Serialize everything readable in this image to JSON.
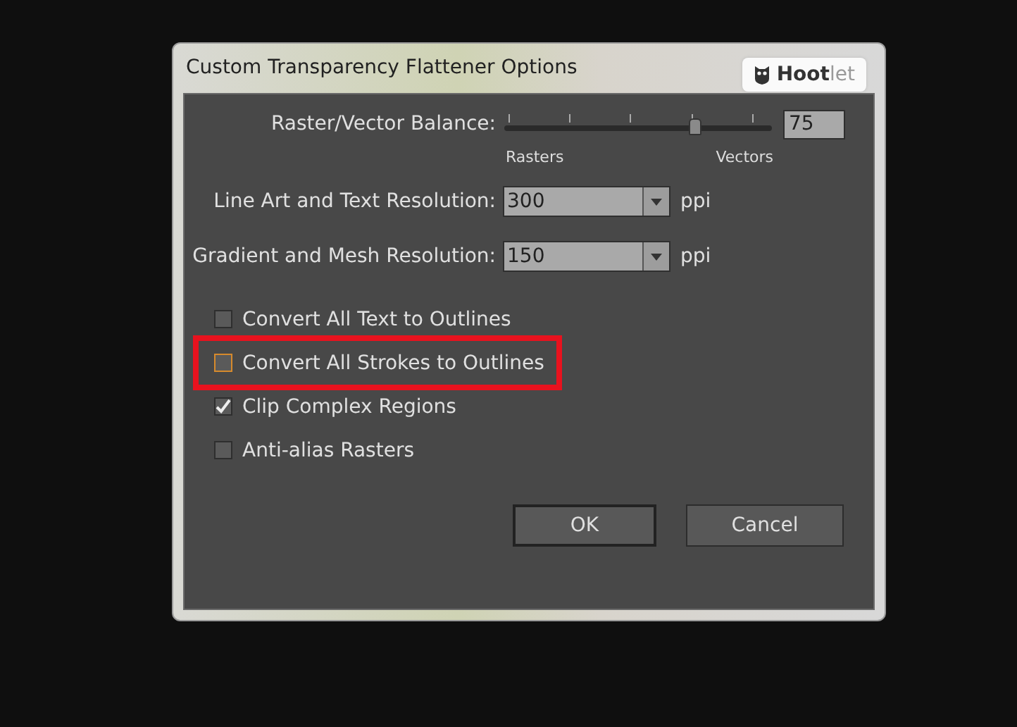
{
  "window": {
    "title": "Custom Transparency Flattener Options"
  },
  "badge": {
    "text": "**Hoot**let"
  },
  "balance": {
    "label": "Raster/Vector Balance:",
    "level": 0.75,
    "value": "75",
    "min_label": "Rasters",
    "max_label": "Vectors"
  },
  "resolutions": [
    {
      "label": "Line Art and Text Resolution:",
      "value": "300",
      "unit": "ppi"
    },
    {
      "label": "Gradient and Mesh Resolution:",
      "value": "150",
      "unit": "ppi"
    }
  ],
  "options": [
    {
      "label": "Convert All Text to Outlines",
      "checked": false,
      "focused": false,
      "highlighted": false
    },
    {
      "label": "Convert All Strokes to Outlines",
      "checked": false,
      "focused": true,
      "highlighted": true
    },
    {
      "label": "Clip Complex Regions",
      "checked": true,
      "focused": false,
      "highlighted": false
    },
    {
      "label": "Anti-alias Rasters",
      "checked": false,
      "focused": false,
      "highlighted": false
    }
  ],
  "buttons": [
    {
      "label": "OK",
      "default": true
    },
    {
      "label": "Cancel",
      "default": false
    }
  ]
}
